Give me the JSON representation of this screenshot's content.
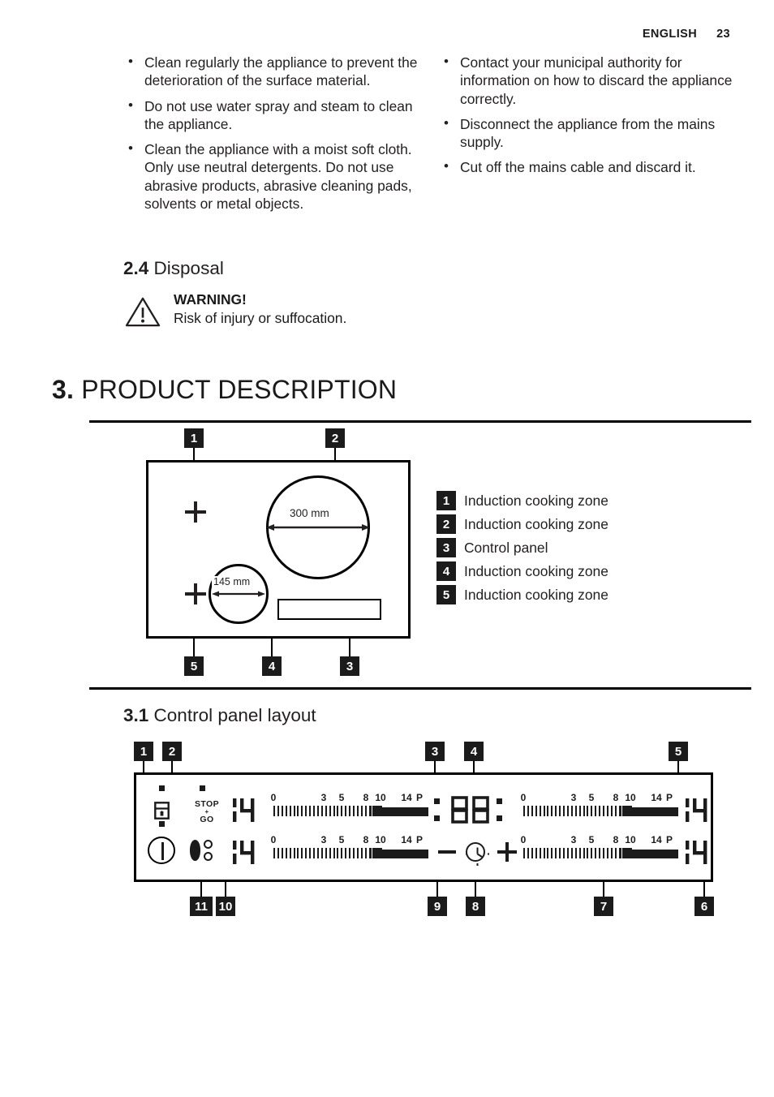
{
  "header": {
    "language": "ENGLISH",
    "page_number": "23"
  },
  "left_column": {
    "bullets": [
      "Clean regularly the appliance to prevent the deterioration of the surface material.",
      "Do not use water spray and steam to clean the appliance.",
      "Clean the appliance with a moist soft cloth. Only use neutral detergents. Do not use abrasive products, abrasive cleaning pads, solvents or metal objects."
    ]
  },
  "right_column": {
    "bullets": [
      "Contact your municipal authority for information on how to discard the appliance correctly.",
      "Disconnect the appliance from the mains supply.",
      "Cut off the mains cable and discard it."
    ]
  },
  "disposal_section": {
    "number": "2.4",
    "title": "Disposal",
    "warning_title": "WARNING!",
    "warning_text": "Risk of injury or suffocation.",
    "warning_icon": "warning-triangle-icon"
  },
  "product_description": {
    "number": "3.",
    "title": "PRODUCT DESCRIPTION"
  },
  "hob_figure": {
    "callouts": [
      "1",
      "2",
      "5",
      "4",
      "3"
    ],
    "dimension_large": "300 mm",
    "dimension_small": "145 mm",
    "legend": [
      {
        "number": "1",
        "label": "Induction cooking zone"
      },
      {
        "number": "2",
        "label": "Induction cooking zone"
      },
      {
        "number": "3",
        "label": "Control panel"
      },
      {
        "number": "4",
        "label": "Induction cooking zone"
      },
      {
        "number": "5",
        "label": "Induction cooking zone"
      }
    ]
  },
  "control_panel_section": {
    "number": "3.1",
    "title": "Control panel layout",
    "callouts_top": [
      "1",
      "2",
      "3",
      "4",
      "5"
    ],
    "callouts_bottom": [
      "11",
      "10",
      "9",
      "8",
      "7",
      "6"
    ],
    "icons": {
      "lock": "lock-icon",
      "power": "power-icon",
      "stop_go_line1": "STOP",
      "stop_go_plus": "+",
      "stop_go_line2": "GO",
      "zone_select": "zone-select-icon",
      "timer_minus": "minus-icon",
      "timer_clock": "clock-icon",
      "timer_plus": "plus-icon"
    },
    "displays": {
      "heat_setting": "14",
      "timer": "88"
    },
    "scale_labels": [
      "0",
      "3",
      "5",
      "8",
      "10",
      "14",
      "P"
    ]
  },
  "colors": {
    "ink": "#231f20",
    "callout_bg": "#1b1b1b",
    "callout_fg": "#ffffff",
    "page_bg": "#ffffff"
  }
}
